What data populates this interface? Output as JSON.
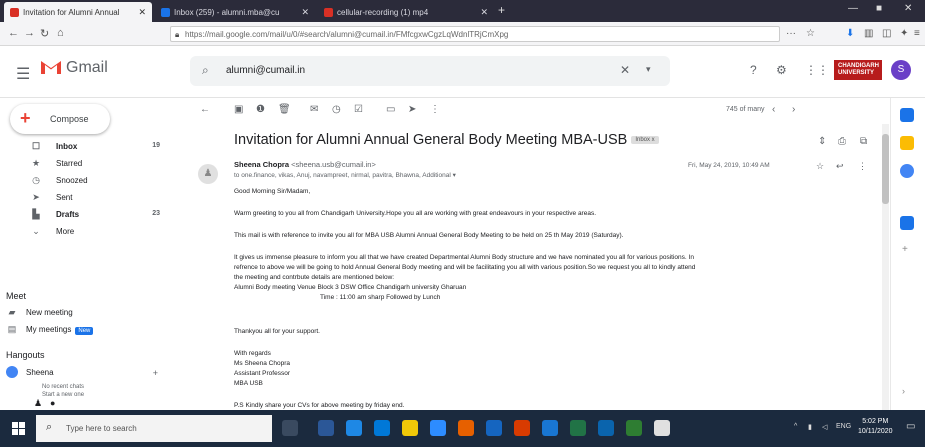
{
  "browser": {
    "tabs": [
      {
        "label": "Invitation for Alumni Annual",
        "favicon_color": "#d93025",
        "active": true
      },
      {
        "label": "Inbox (259) - alumni.mba@cu",
        "favicon_color": "#1a73e8",
        "active": false
      },
      {
        "label": "cellular-recording (1) mp4",
        "favicon_color": "#d93025",
        "active": false
      }
    ],
    "url": "https://mail.google.com/mail/u/0/#search/alumni@cumail.in/FMfcgxwCgzLqWdnlTRjCmXpg"
  },
  "gmail": {
    "logo_text": "Gmail",
    "search_value": "alumni@cumail.in",
    "avatar_letter": "S",
    "brand_text": [
      "CHANDIGARH",
      "UNIVERSITY"
    ],
    "compose_label": "Compose",
    "nav": [
      {
        "label": "Inbox",
        "count": "19",
        "icon": "inbox-icon",
        "bold": true
      },
      {
        "label": "Starred",
        "count": "",
        "icon": "star-icon",
        "bold": false
      },
      {
        "label": "Snoozed",
        "count": "",
        "icon": "clock-icon",
        "bold": false
      },
      {
        "label": "Sent",
        "count": "",
        "icon": "send-icon",
        "bold": false
      },
      {
        "label": "Drafts",
        "count": "23",
        "icon": "draft-icon",
        "bold": true
      },
      {
        "label": "More",
        "count": "",
        "icon": "chevron-down-icon",
        "bold": false
      }
    ],
    "meet_heading": "Meet",
    "meet_items": [
      "New meeting",
      "My meetings"
    ],
    "meet_badge": "New",
    "hangouts_heading": "Hangouts",
    "hangouts_user": "Sheena",
    "hangouts_empty": [
      "No recent chats",
      "Start a new one"
    ]
  },
  "email": {
    "pager": "745 of many",
    "subject": "Invitation for Alumni Annual General Body Meeting MBA-USB",
    "subject_tag": "Inbox x",
    "sender_name": "Sheena Chopra",
    "sender_email": "<sheena.usb@cumail.in>",
    "recipients": "to one.finance, vikas, Anuj, navampreet, nirmal, pavitra, Bhawna, Additional",
    "date": "Fri, May 24, 2019, 10:49 AM",
    "body": [
      "Good Morning Sir/Madam,",
      "Warm greeting to you all from Chandigarh University.Hope you all are working with great endeavours in  your respective areas.",
      "This mail is with reference to invite you all for MBA USB Alumni Annual General Body Meeting to be held on 25 th May 2019 (Saturday).",
      "It gives us immense pleasure to inform you all that we have created Departmental Alumni Body structure and we have nominated you all for various positions. In",
      "refrence to above we will be going to hold  Annual General Body meeting and will  be facilitating you all with various position.So we request you all to kindly attend",
      "the meeting and contrbute details are mentioned below:",
      "Alumni Body meeting Venue Block 3 DSW Office Chandigarh university Gharuan",
      "Time : 11:00 am sharp Followed by Lunch",
      "Thankyou all for your support.",
      "With regards",
      "Ms Sheena Chopra",
      "Assistant Professor",
      "MBA USB",
      "P.S Kindly share your CVs for above meeting by friday end."
    ]
  },
  "taskbar": {
    "search_placeholder": "Type here to search",
    "time": "5:02 PM",
    "date": "10/11/2020"
  }
}
